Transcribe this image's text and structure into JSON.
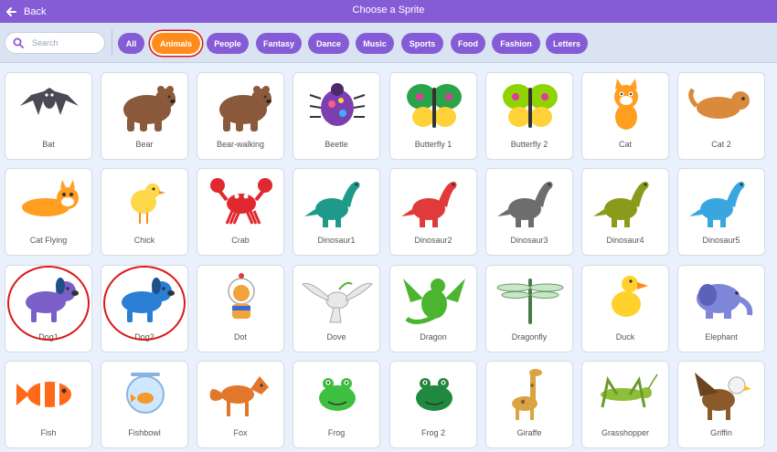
{
  "header": {
    "back_label": "Back",
    "title": "Choose a Sprite"
  },
  "search": {
    "placeholder": "Search",
    "value": ""
  },
  "tags": [
    {
      "label": "All",
      "active": false
    },
    {
      "label": "Animals",
      "active": true
    },
    {
      "label": "People",
      "active": false
    },
    {
      "label": "Fantasy",
      "active": false
    },
    {
      "label": "Dance",
      "active": false
    },
    {
      "label": "Music",
      "active": false
    },
    {
      "label": "Sports",
      "active": false
    },
    {
      "label": "Food",
      "active": false
    },
    {
      "label": "Fashion",
      "active": false
    },
    {
      "label": "Letters",
      "active": false
    }
  ],
  "sprites": [
    {
      "name": "Bat",
      "icon": "bat-icon",
      "color": "#4a4a56"
    },
    {
      "name": "Bear",
      "icon": "bear-icon",
      "color": "#8b5a3c"
    },
    {
      "name": "Bear-walking",
      "icon": "bear-walking-icon",
      "color": "#8b5a3c"
    },
    {
      "name": "Beetle",
      "icon": "beetle-icon",
      "color": "#7d3fb0"
    },
    {
      "name": "Butterfly 1",
      "icon": "butterfly-1-icon",
      "color": "#2aa34a"
    },
    {
      "name": "Butterfly 2",
      "icon": "butterfly-2-icon",
      "color": "#8fd400"
    },
    {
      "name": "Cat",
      "icon": "cat-icon",
      "color": "#ff9e1f"
    },
    {
      "name": "Cat 2",
      "icon": "cat-2-icon",
      "color": "#d98a3a"
    },
    {
      "name": "Cat Flying",
      "icon": "cat-flying-icon",
      "color": "#ff9e1f"
    },
    {
      "name": "Chick",
      "icon": "chick-icon",
      "color": "#ffd84a"
    },
    {
      "name": "Crab",
      "icon": "crab-icon",
      "color": "#e0282e"
    },
    {
      "name": "Dinosaur1",
      "icon": "dinosaur1-icon",
      "color": "#1f9a8a"
    },
    {
      "name": "Dinosaur2",
      "icon": "dinosaur2-icon",
      "color": "#e03a3a"
    },
    {
      "name": "Dinosaur3",
      "icon": "dinosaur3-icon",
      "color": "#6d6d6d"
    },
    {
      "name": "Dinosaur4",
      "icon": "dinosaur4-icon",
      "color": "#8a9a1a"
    },
    {
      "name": "Dinosaur5",
      "icon": "dinosaur5-icon",
      "color": "#3aa6e0"
    },
    {
      "name": "Dog1",
      "icon": "dog1-icon",
      "color": "#7a5fc8",
      "ring": true
    },
    {
      "name": "Dog2",
      "icon": "dog2-icon",
      "color": "#2a7fd4",
      "ring": true
    },
    {
      "name": "Dot",
      "icon": "dot-icon",
      "color": "#f2a33a"
    },
    {
      "name": "Dove",
      "icon": "dove-icon",
      "color": "#e8e8e8"
    },
    {
      "name": "Dragon",
      "icon": "dragon-icon",
      "color": "#4bb531"
    },
    {
      "name": "Dragonfly",
      "icon": "dragonfly-icon",
      "color": "#4a7a4a"
    },
    {
      "name": "Duck",
      "icon": "duck-icon",
      "color": "#ffd12a"
    },
    {
      "name": "Elephant",
      "icon": "elephant-icon",
      "color": "#7d86d9"
    },
    {
      "name": "Fish",
      "icon": "fish-icon",
      "color": "#ff6a1a"
    },
    {
      "name": "Fishbowl",
      "icon": "fishbowl-icon",
      "color": "#f29a2a"
    },
    {
      "name": "Fox",
      "icon": "fox-icon",
      "color": "#e0772a"
    },
    {
      "name": "Frog",
      "icon": "frog-icon",
      "color": "#3fbf3f"
    },
    {
      "name": "Frog 2",
      "icon": "frog-2-icon",
      "color": "#1f8a3f"
    },
    {
      "name": "Giraffe",
      "icon": "giraffe-icon",
      "color": "#d9a441"
    },
    {
      "name": "Grasshopper",
      "icon": "grasshopper-icon",
      "color": "#8fbf3a"
    },
    {
      "name": "Griffin",
      "icon": "griffin-icon",
      "color": "#8b5a2b"
    }
  ],
  "colors": {
    "header": "#855cd6",
    "tag": "#855cd6",
    "tag_active": "#ff8c1a",
    "highlight_ring": "#d91a1a",
    "background": "#e9f1fc"
  }
}
